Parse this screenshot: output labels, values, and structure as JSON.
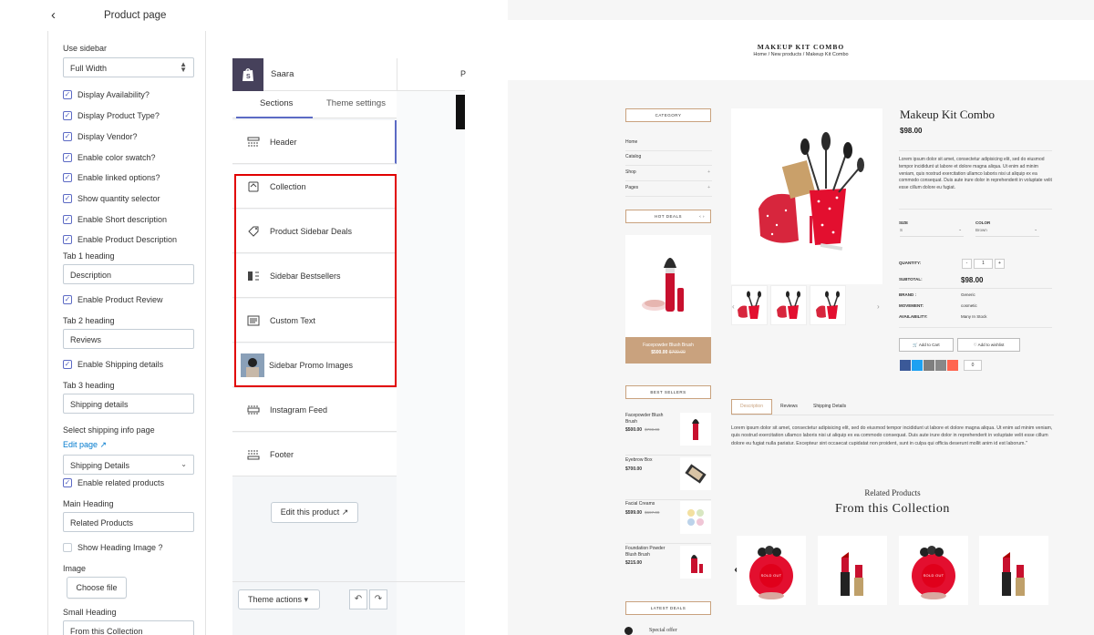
{
  "settings_panel": {
    "title": "Product page",
    "back_icon": "chevron-left-icon",
    "use_sidebar_label": "Use sidebar",
    "use_sidebar_value": "Full Width",
    "checkboxes_a": [
      {
        "label": "Display Availability?",
        "checked": true
      },
      {
        "label": "Display Product Type?",
        "checked": true
      },
      {
        "label": "Display Vendor?",
        "checked": true
      },
      {
        "label": "Enable color swatch?",
        "checked": true
      },
      {
        "label": "Enable linked options?",
        "checked": true
      },
      {
        "label": "Show quantity selector",
        "checked": true
      },
      {
        "label": "Enable Short description",
        "checked": true
      },
      {
        "label": "Enable Product Description",
        "checked": true
      }
    ],
    "tab1_heading_label": "Tab 1 heading",
    "tab1_heading_value": "Description",
    "enable_review_label": "Enable Product Review",
    "tab2_heading_label": "Tab 2 heading",
    "tab2_heading_value": "Reviews",
    "enable_shipping_label": "Enable Shipping details",
    "tab3_heading_label": "Tab 3 heading",
    "tab3_heading_value": "Shipping details",
    "select_shipping_label": "Select shipping info page",
    "edit_page_link": "Edit page",
    "shipping_select_value": "Shipping Details",
    "enable_related_label": "Enable related products",
    "main_heading_label": "Main Heading",
    "main_heading_value": "Related Products",
    "show_heading_image_label": "Show Heading Image ?",
    "image_label": "Image",
    "choose_file_label": "Choose file",
    "small_heading_label": "Small Heading",
    "small_heading_value": "From this Collection"
  },
  "editor_panel": {
    "store_name": "Saara",
    "topbar_right_char": "P",
    "tabs": [
      "Sections",
      "Theme settings"
    ],
    "sections": [
      {
        "label": "Header",
        "icon": "header-layout-icon"
      },
      {
        "label": "Collection",
        "icon": "collection-icon"
      },
      {
        "label": "Product Sidebar Deals",
        "icon": "tag-icon"
      },
      {
        "label": "Sidebar Bestsellers",
        "icon": "sidebar-icon"
      },
      {
        "label": "Custom Text",
        "icon": "text-block-icon"
      },
      {
        "label": "Sidebar Promo Images",
        "icon": "promo-image-thumbnail"
      },
      {
        "label": "Instagram Feed",
        "icon": "gallery-icon"
      },
      {
        "label": "Footer",
        "icon": "footer-layout-icon"
      }
    ],
    "edit_product_label": "Edit this product",
    "theme_actions_label": "Theme actions",
    "highlight_color": "#e10000",
    "accent_color": "#5c6ac4"
  },
  "storefront": {
    "page_title": "MAKEUP KIT COMBO",
    "breadcrumb": "Home  /  New products  /  Makeup Kit Combo",
    "category_title": "CATEGORY",
    "category_items": [
      "Home",
      "Catalog",
      "Shop",
      "Pages"
    ],
    "hot_deals_title": "HOT DEALS",
    "hot_deal": {
      "name": "Facepowder Blush Brush",
      "price": "$500.00",
      "old_price": "$700.00"
    },
    "best_sellers_title": "BEST SELLERS",
    "best_sellers": [
      {
        "name": "Facepowder Blush Brush",
        "price": "$500.00",
        "old_price": "$700.00"
      },
      {
        "name": "Eyebrow Box",
        "price": "$700.00",
        "old_price": ""
      },
      {
        "name": "Facial Creams",
        "price": "$599.00",
        "old_price": "$697.00"
      },
      {
        "name": "Foundation Powder Blush Brush",
        "price": "$215.00",
        "old_price": ""
      }
    ],
    "latest_deals_title": "LATEST DEALS",
    "latest_deal_name": "Special offer",
    "product": {
      "name": "Makeup Kit Combo",
      "price": "$98.00",
      "short_description": "Lorem ipsum dolor sit amet, consectetur adipisicing elit, sed do eiusmod tempor incididunt ut labore et dolore magna aliqua. Ut enim ad minim veniam, quis nostrud exercitation ullamco laboris nisi ut aliquip ex ea commodo consequat. Duis aute irure dolor in reprehenderit in voluptate velit esse cillum dolore eu fugiat.",
      "size_label": "SIZE",
      "size_value": "S",
      "color_label": "COLOR",
      "color_value": "Brown",
      "quantity_label": "QUANTITY:",
      "quantity_value": "1",
      "subtotal_label": "SUBTOTAL:",
      "subtotal_value": "$98.00",
      "brand_label": "BRAND :",
      "brand_value": "Generic",
      "movement_label": "MOVEMENT:",
      "movement_value": "cosmetic",
      "availability_label": "AVAILABILITY:",
      "availability_value": "Many In Stock",
      "add_to_cart": "Add to Cart",
      "add_to_wishlist": "Add to wishlist",
      "share_count": "0"
    },
    "tabs": [
      "Description",
      "Reviews",
      "Shipping Details"
    ],
    "description": "Lorem ipsum dolor sit amet, consectetur adipisicing elit, sed do eiusmod tempor incididunt ut labore et dolore magna aliqua. Ut enim ad minim veniam, quis nostrud exercitation ullamco laboris nisi ut aliquip ex ea commodo consequat. Duis aute irure dolor in reprehenderit in voluptate velit esse cillum dolore eu fugiat nulla pariatur. Excepteur sint occaecat cupidatat non proident, sunt in culpa qui officia deserunt mollit anim id est laborum.\"",
    "related_small": "Related Products",
    "related_main": "From this Collection",
    "sold_out": "SOLD OUT",
    "accent_color": "#c9a27e"
  }
}
